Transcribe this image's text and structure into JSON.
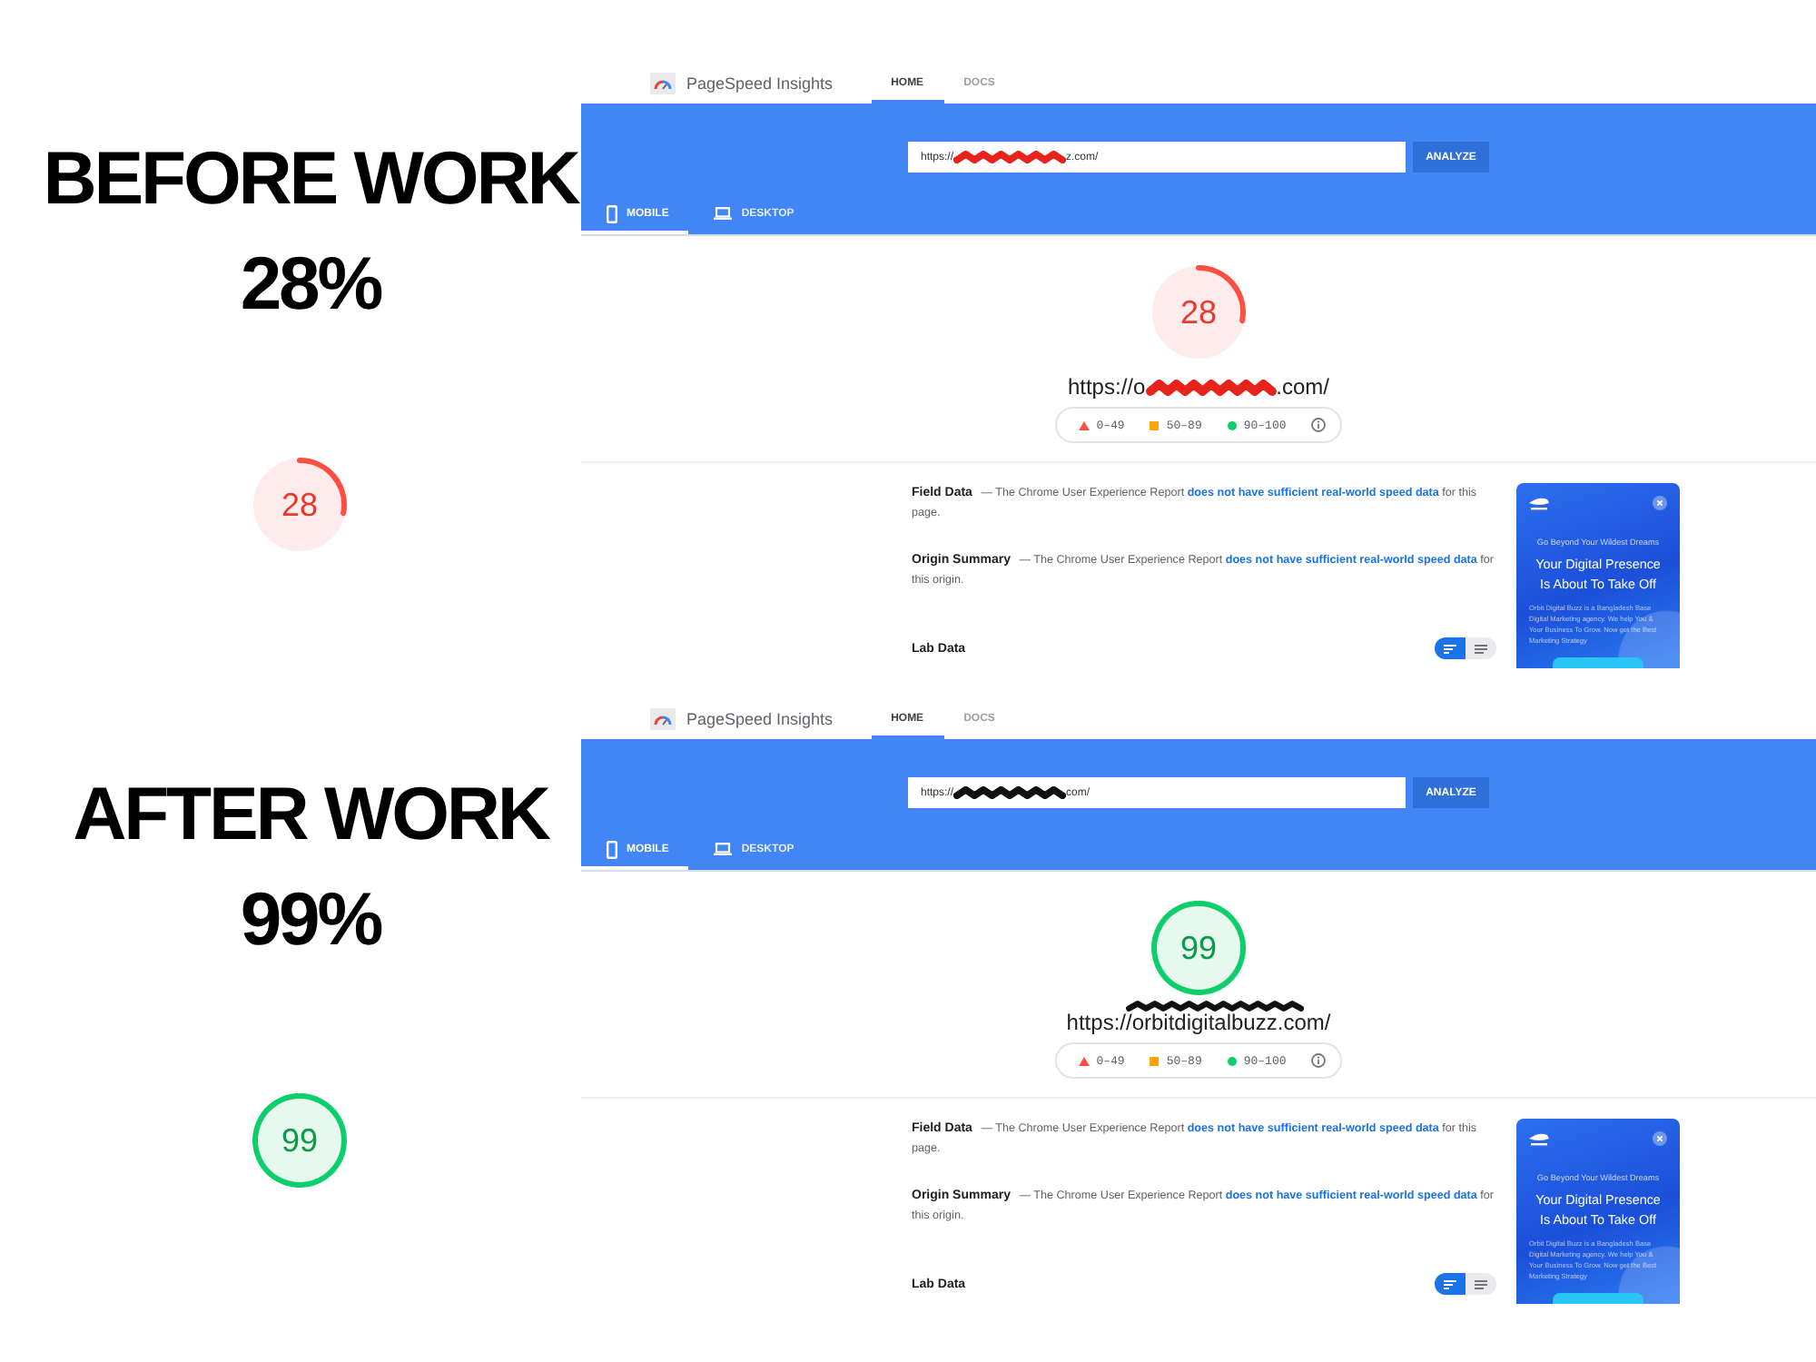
{
  "panels": [
    {
      "heading": "BEFORE WORK",
      "percent": "28%",
      "badge": {
        "score": "28"
      },
      "report": {
        "brand": "PageSpeed Insights",
        "nav": [
          {
            "label": "HOME",
            "selected": true
          },
          {
            "label": "DOCS",
            "selected": false
          }
        ],
        "url_field": {
          "parts": [
            "https://",
            "z.com/"
          ],
          "redaction": {
            "kind": "inline",
            "color": "#e8231c"
          }
        },
        "analyze_button": "ANALYZE",
        "devices": [
          {
            "label": "MOBILE",
            "kind": "phone",
            "selected": true
          },
          {
            "label": "DESKTOP",
            "kind": "laptop",
            "selected": false
          }
        ],
        "gauge": {
          "score": "28"
        },
        "url": {
          "parts": [
            "https://o",
            ".com/"
          ],
          "redaction": {
            "kind": "inline",
            "color": "#e8231c"
          }
        },
        "legend": [
          {
            "kind": "fail",
            "label": "0–49"
          },
          {
            "kind": "average",
            "label": "50–89"
          },
          {
            "kind": "pass",
            "label": "90–100"
          }
        ],
        "sections": [
          {
            "title": "Field Data",
            "text_before": "— The Chrome User Experience Report",
            "link": "does not have sufficient real-world speed data",
            "text_after": "for this page."
          },
          {
            "title": "Origin Summary",
            "text_before": "— The Chrome User Experience Report",
            "link": "does not have sufficient real-world speed data",
            "text_after": "for this origin."
          }
        ],
        "lab_data": {
          "title": "Lab Data",
          "view_toggle": [
            {
              "kind": "bars",
              "selected": true
            },
            {
              "kind": "lines",
              "selected": false
            }
          ]
        },
        "ad": {
          "tagline": "Go Beyond Your Wildest Dreams",
          "headline": "Your Digital Presence Is About To Take Off",
          "body": "Orbit Digital Buzz is a Bangladesh Base Digital Marketing agency. We help You & Your Business To Grow. Now get the Best Marketing Strategy"
        }
      }
    },
    {
      "heading": "AFTER WORK",
      "percent": "99%",
      "badge": {
        "score": "99"
      },
      "report": {
        "brand": "PageSpeed Insights",
        "nav": [
          {
            "label": "HOME",
            "selected": true
          },
          {
            "label": "DOCS",
            "selected": false
          }
        ],
        "url_field": {
          "parts": [
            "https://",
            "com/"
          ],
          "redaction": {
            "kind": "inline",
            "color": "#111111"
          }
        },
        "analyze_button": "ANALYZE",
        "devices": [
          {
            "label": "MOBILE",
            "kind": "phone",
            "selected": true
          },
          {
            "label": "DESKTOP",
            "kind": "laptop",
            "selected": false
          }
        ],
        "gauge": {
          "score": "99"
        },
        "url": {
          "parts": [
            "https://orbitdigitalbuzz.com/"
          ],
          "redaction": {
            "kind": "above",
            "color": "#111111"
          }
        },
        "legend": [
          {
            "kind": "fail",
            "label": "0–49"
          },
          {
            "kind": "average",
            "label": "50–89"
          },
          {
            "kind": "pass",
            "label": "90–100"
          }
        ],
        "sections": [
          {
            "title": "Field Data",
            "text_before": "— The Chrome User Experience Report",
            "link": "does not have sufficient real-world speed data",
            "text_after": "for this page."
          },
          {
            "title": "Origin Summary",
            "text_before": "— The Chrome User Experience Report",
            "link": "does not have sufficient real-world speed data",
            "text_after": "for this origin."
          }
        ],
        "lab_data": {
          "title": "Lab Data",
          "view_toggle": [
            {
              "kind": "bars",
              "selected": true
            },
            {
              "kind": "lines",
              "selected": false
            }
          ]
        },
        "ad": {
          "tagline": "Go Beyond Your Wildest Dreams",
          "headline": "Your Digital Presence Is About To Take Off",
          "body": "Orbit Digital Buzz is a Bangladesh Base Digital Marketing agency. We help You & Your Business To Grow. Now get the Best Marketing Strategy"
        }
      }
    }
  ]
}
